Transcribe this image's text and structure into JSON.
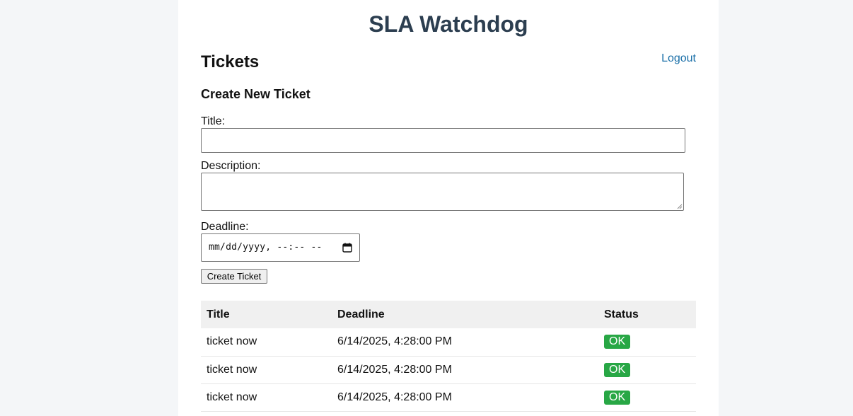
{
  "app": {
    "title": "SLA Watchdog"
  },
  "page": {
    "heading": "Tickets",
    "logout_label": "Logout"
  },
  "form": {
    "heading": "Create New Ticket",
    "title_label": "Title:",
    "title_value": "",
    "description_label": "Description:",
    "description_value": "",
    "deadline_label": "Deadline:",
    "deadline_placeholder": "mm/dd/yyyy, --:-- --",
    "submit_label": "Create Ticket"
  },
  "table": {
    "columns": [
      "Title",
      "Deadline",
      "Status"
    ],
    "rows": [
      {
        "title": "ticket now",
        "deadline": "6/14/2025, 4:28:00 PM",
        "status": "OK"
      },
      {
        "title": "ticket now",
        "deadline": "6/14/2025, 4:28:00 PM",
        "status": "OK"
      },
      {
        "title": "ticket now",
        "deadline": "6/14/2025, 4:28:00 PM",
        "status": "OK"
      }
    ]
  },
  "colors": {
    "title": "#2c3e50",
    "link": "#1a6fa8",
    "status_ok": "#28a745"
  },
  "icons": {
    "deadline_picker": "calendar-icon",
    "textarea_resize": "resize-grip-icon"
  }
}
